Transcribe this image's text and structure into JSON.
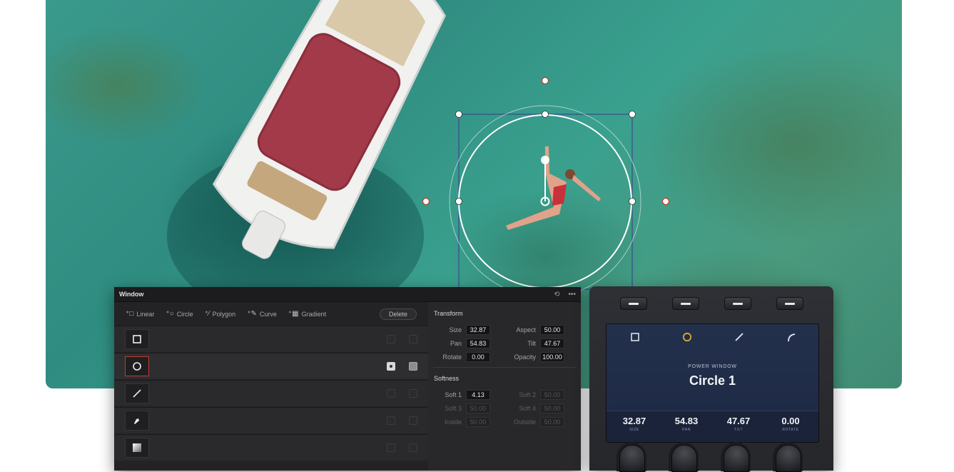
{
  "window_panel": {
    "title": "Window",
    "toolbar": {
      "linear": "Linear",
      "circle": "Circle",
      "polygon": "Polygon",
      "curve": "Curve",
      "gradient": "Gradient",
      "delete": "Delete"
    },
    "shapes": [
      "square",
      "circle",
      "line",
      "pen",
      "gradient"
    ],
    "selected_shape_index": 1,
    "transform": {
      "title": "Transform",
      "size_label": "Size",
      "size": "32.87",
      "aspect_label": "Aspect",
      "aspect": "50.00",
      "pan_label": "Pan",
      "pan": "54.83",
      "tilt_label": "Tilt",
      "tilt": "47.67",
      "rotate_label": "Rotate",
      "rotate": "0.00",
      "opacity_label": "Opacity",
      "opacity": "100.00"
    },
    "softness": {
      "title": "Softness",
      "soft1_label": "Soft 1",
      "soft1": "4.13",
      "soft2_label": "Soft 2",
      "soft2": "50.00",
      "soft3_label": "Soft 3",
      "soft3": "50.00",
      "soft4_label": "Soft 4",
      "soft4": "50.00",
      "inside_label": "Inside",
      "inside": "50.00",
      "outside_label": "Outside",
      "outside": "50.00"
    }
  },
  "control_panel": {
    "screen_label": "POWER WINDOW",
    "window_name": "Circle 1",
    "accent_color": "#e2a72e",
    "metrics": [
      {
        "value": "32.87",
        "label": "SIZE"
      },
      {
        "value": "54.83",
        "label": "PAN"
      },
      {
        "value": "47.67",
        "label": "TILT"
      },
      {
        "value": "0.00",
        "label": "ROTATE"
      }
    ]
  }
}
